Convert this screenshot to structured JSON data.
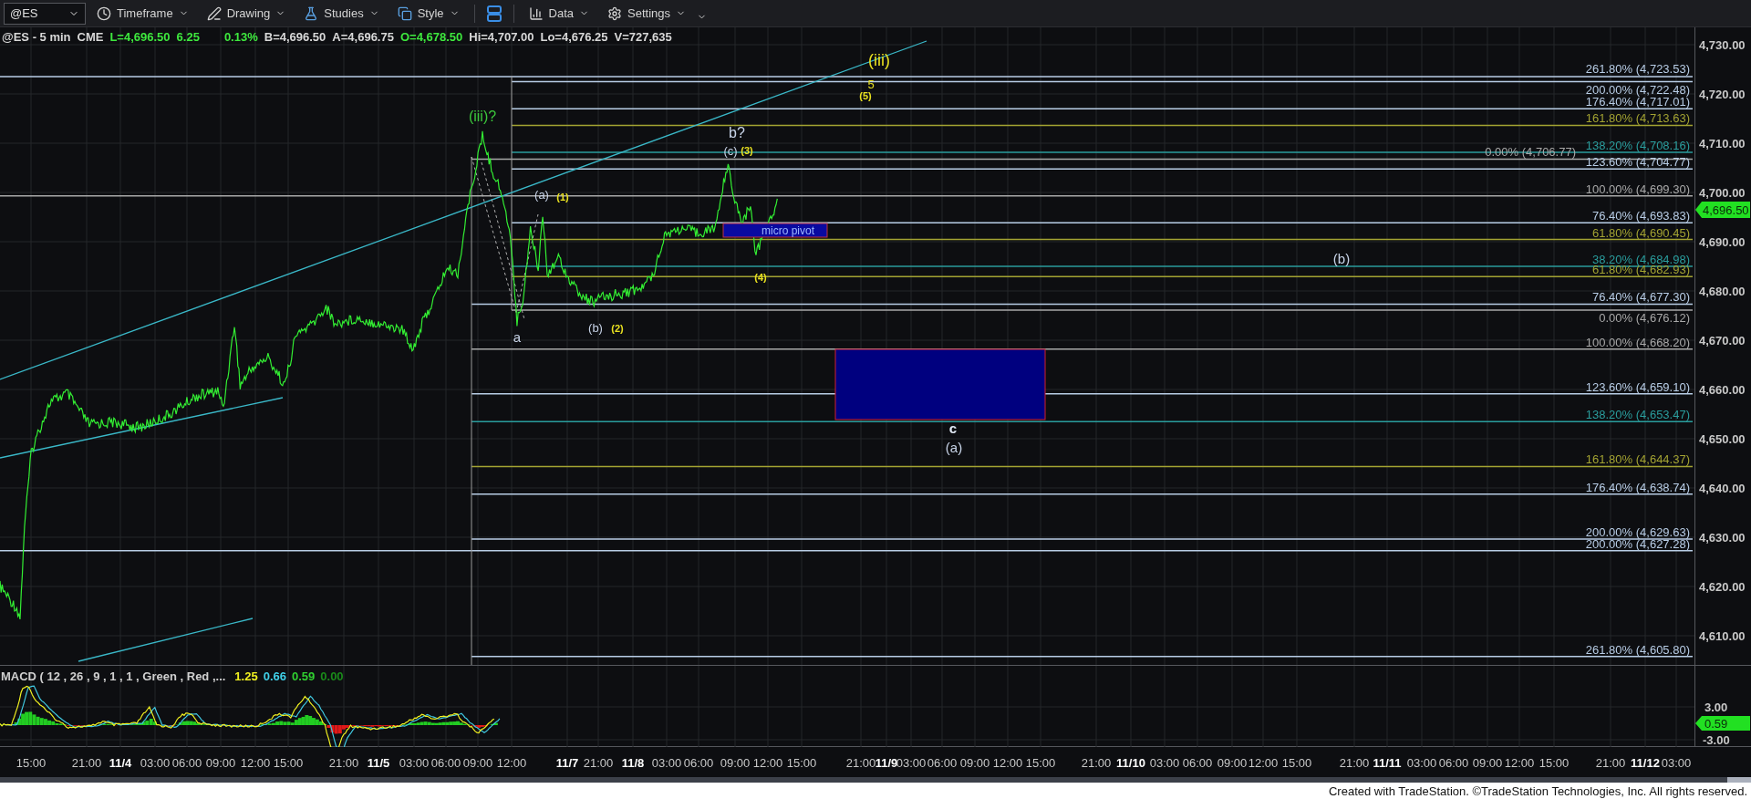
{
  "toolbar": {
    "symbol": "@ES",
    "menus": [
      {
        "label": "Timeframe",
        "kind": "timeframe"
      },
      {
        "label": "Drawing",
        "kind": "drawing"
      },
      {
        "label": "Studies",
        "kind": "studies"
      },
      {
        "label": "Style",
        "kind": "style"
      },
      {
        "label": "Data",
        "kind": "data"
      },
      {
        "label": "Settings",
        "kind": "settings"
      }
    ]
  },
  "quote": [
    {
      "text": "@ES - 5 min",
      "color": "#d8d8d8"
    },
    {
      "text": "CME",
      "color": "#d8d8d8"
    },
    {
      "text": "L=4,696.50",
      "color": "#3ee83e"
    },
    {
      "text": "6.25",
      "color": "#3ee83e"
    },
    {
      "text": "0.13%",
      "color": "#3ee83e"
    },
    {
      "text": "B=4,696.50",
      "color": "#d8d8d8"
    },
    {
      "text": "A=4,696.75",
      "color": "#d8d8d8"
    },
    {
      "text": "O=4,678.50",
      "color": "#3ee83e"
    },
    {
      "text": "Hi=4,707.00",
      "color": "#d8d8d8"
    },
    {
      "text": "Lo=4,676.25",
      "color": "#d8d8d8"
    },
    {
      "text": "V=727,635",
      "color": "#d8d8d8"
    }
  ],
  "chart": {
    "fib_levels": [
      {
        "label": "261.80% (4,723.53)",
        "color": "#b8cde6"
      },
      {
        "label": "200.00% (4,722.48)",
        "color": "#b8cde6"
      },
      {
        "label": "176.40% (4,717.01)",
        "color": "#b8cde6"
      },
      {
        "label": "161.80% (4,713.63)",
        "color": "#a3a332"
      },
      {
        "label": "138.20% (4,708.16)",
        "color": "#2a9d9d"
      },
      {
        "label": "0.00% (4,706.77)",
        "color": "#a8a8a8"
      },
      {
        "label": "123.60% (4,704.77)",
        "color": "#b8cde6"
      },
      {
        "label": "100.00% (4,699.30)",
        "color": "#a8a8a8"
      },
      {
        "label": "76.40% (4,693.83)",
        "color": "#b8cde6"
      },
      {
        "label": "61.80% (4,690.45)",
        "color": "#a3a332"
      },
      {
        "label": "38.20% (4,684.98)",
        "color": "#2a9d9d"
      },
      {
        "label": "61.80% (4,682.93)",
        "color": "#a3a332"
      },
      {
        "label": "76.40% (4,677.30)",
        "color": "#b8cde6"
      },
      {
        "label": "0.00% (4,676.12)",
        "color": "#a8a8a8"
      },
      {
        "label": "100.00% (4,668.20)",
        "color": "#a8a8a8"
      },
      {
        "label": "123.60% (4,659.10)",
        "color": "#b8cde6"
      },
      {
        "label": "138.20% (4,653.47)",
        "color": "#2a9d9d"
      },
      {
        "label": "161.80% (4,644.37)",
        "color": "#a3a332"
      },
      {
        "label": "176.40% (4,638.74)",
        "color": "#b8cde6"
      },
      {
        "label": "200.00% (4,629.63)",
        "color": "#b8cde6"
      },
      {
        "label": "200.00% (4,627.28)",
        "color": "#b8cde6"
      },
      {
        "label": "261.80% (4,605.80)",
        "color": "#b8cde6"
      }
    ],
    "wave_labels": [
      {
        "text": "(iii)?",
        "color": "#3cc83c"
      },
      {
        "text": "(iii)",
        "color": "#e8e020"
      },
      {
        "text": "5",
        "color": "#e8e020"
      },
      {
        "text": "(5)",
        "color": "#e8e020"
      },
      {
        "text": "b?",
        "color": "#c8d4e8"
      },
      {
        "text": "(c)",
        "color": "#c8d4e8"
      },
      {
        "text": "(3)",
        "color": "#e8e020"
      },
      {
        "text": "(a)",
        "color": "#c8d4e8"
      },
      {
        "text": "(1)",
        "color": "#e8e020"
      },
      {
        "text": "a",
        "color": "#c8d4e8"
      },
      {
        "text": "(b)",
        "color": "#c8d4e8"
      },
      {
        "text": "(2)",
        "color": "#e8e020"
      },
      {
        "text": "(4)",
        "color": "#e8e020"
      },
      {
        "text": "(b)",
        "color": "#c8d4e8"
      },
      {
        "text": "c",
        "color": "#e0e8f4"
      },
      {
        "text": "(a)",
        "color": "#c8d4e8"
      }
    ],
    "zone_label": "micro pivot",
    "price_axis": [
      "4,730.00",
      "4,720.00",
      "4,710.00",
      "4,700.00",
      "4,690.00",
      "4,680.00",
      "4,670.00",
      "4,660.00",
      "4,650.00",
      "4,640.00",
      "4,630.00",
      "4,620.00",
      "4,610.00"
    ],
    "last_price": "4,696.50"
  },
  "macd": {
    "title": "MACD ( 12 , 26 , 9 , 1 , 1 , Green , Red ,...",
    "values": [
      {
        "text": "1.25",
        "color": "#f0f020"
      },
      {
        "text": "0.66",
        "color": "#40d0e8"
      },
      {
        "text": "0.59",
        "color": "#30d030"
      },
      {
        "text": "0.00",
        "color": "#1a8a1a"
      }
    ],
    "axis": [
      "3.00",
      "-3.00"
    ],
    "last_value": "0.59"
  },
  "time_axis": [
    {
      "text": "15:00",
      "kind": "time"
    },
    {
      "text": "21:00",
      "kind": "time"
    },
    {
      "text": "11/4",
      "kind": "date"
    },
    {
      "text": "03:00",
      "kind": "time"
    },
    {
      "text": "06:00",
      "kind": "time"
    },
    {
      "text": "09:00",
      "kind": "time"
    },
    {
      "text": "12:00",
      "kind": "time"
    },
    {
      "text": "15:00",
      "kind": "time"
    },
    {
      "text": "21:00",
      "kind": "time"
    },
    {
      "text": "11/5",
      "kind": "date"
    },
    {
      "text": "03:00",
      "kind": "time"
    },
    {
      "text": "06:00",
      "kind": "time"
    },
    {
      "text": "09:00",
      "kind": "time"
    },
    {
      "text": "12:00",
      "kind": "time"
    },
    {
      "text": "11/7",
      "kind": "date"
    },
    {
      "text": "21:00",
      "kind": "time"
    },
    {
      "text": "11/8",
      "kind": "date"
    },
    {
      "text": "03:00",
      "kind": "time"
    },
    {
      "text": "06:00",
      "kind": "time"
    },
    {
      "text": "09:00",
      "kind": "time"
    },
    {
      "text": "12:00",
      "kind": "time"
    },
    {
      "text": "15:00",
      "kind": "time"
    },
    {
      "text": "21:00",
      "kind": "time"
    },
    {
      "text": "11/9",
      "kind": "date"
    },
    {
      "text": "03:00",
      "kind": "time"
    },
    {
      "text": "06:00",
      "kind": "time"
    },
    {
      "text": "09:00",
      "kind": "time"
    },
    {
      "text": "12:00",
      "kind": "time"
    },
    {
      "text": "15:00",
      "kind": "time"
    },
    {
      "text": "21:00",
      "kind": "time"
    },
    {
      "text": "11/10",
      "kind": "date"
    },
    {
      "text": "03:00",
      "kind": "time"
    },
    {
      "text": "06:00",
      "kind": "time"
    },
    {
      "text": "09:00",
      "kind": "time"
    },
    {
      "text": "12:00",
      "kind": "time"
    },
    {
      "text": "15:00",
      "kind": "time"
    },
    {
      "text": "21:00",
      "kind": "time"
    },
    {
      "text": "11/11",
      "kind": "date"
    },
    {
      "text": "03:00",
      "kind": "time"
    },
    {
      "text": "06:00",
      "kind": "time"
    },
    {
      "text": "09:00",
      "kind": "time"
    },
    {
      "text": "12:00",
      "kind": "time"
    },
    {
      "text": "15:00",
      "kind": "time"
    },
    {
      "text": "21:00",
      "kind": "time"
    },
    {
      "text": "11/12",
      "kind": "date"
    },
    {
      "text": "03:00",
      "kind": "time"
    }
  ],
  "footer": "Created with TradeStation. ©TradeStation Technologies, Inc. All rights reserved."
}
